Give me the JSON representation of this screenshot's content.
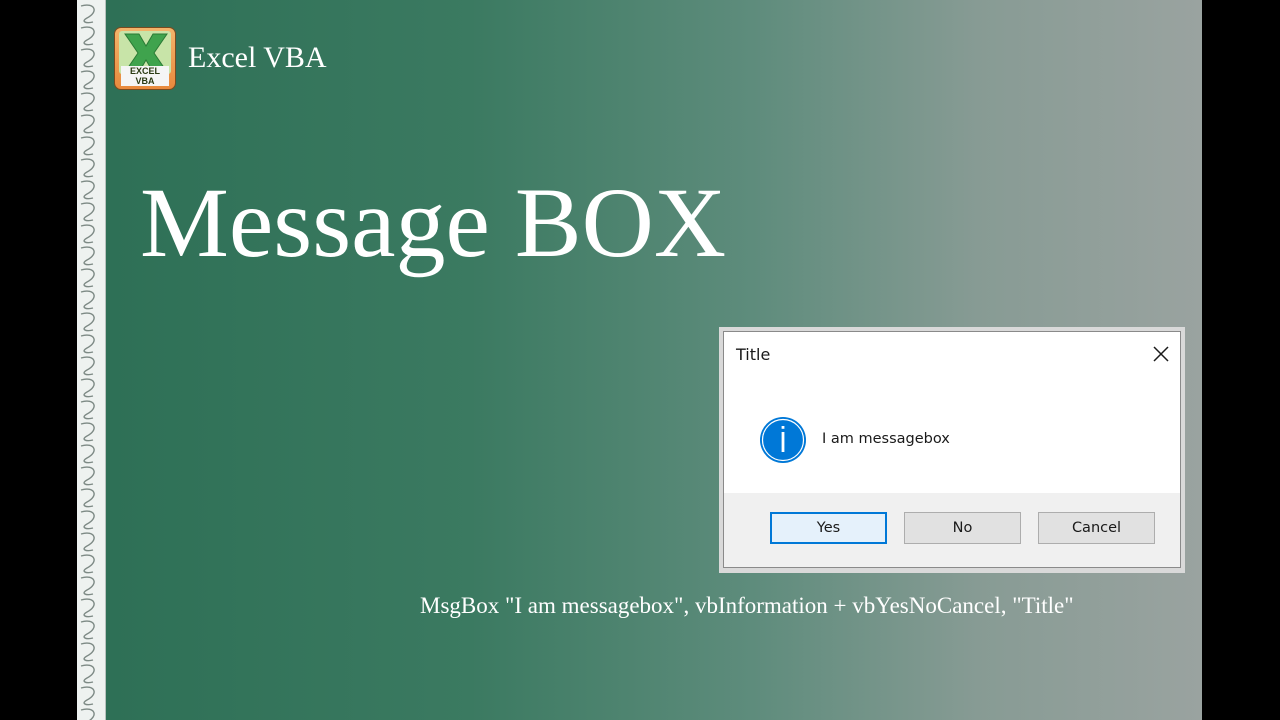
{
  "brand": {
    "logo_text": "EXCEL VBA",
    "name": "Excel VBA"
  },
  "headline": "Message BOX",
  "dialog": {
    "title": "Title",
    "message": "I am messagebox",
    "icon": "info-icon",
    "buttons": {
      "yes": "Yes",
      "no": "No",
      "cancel": "Cancel"
    },
    "default_button": "Yes"
  },
  "code_line": "MsgBox \"I am messagebox\", vbInformation + vbYesNoCancel, \"Title\"",
  "colors": {
    "slide_left": "#2d6f55",
    "slide_right": "#9aa3a0",
    "info_blue": "#0078d7",
    "logo_orange": "#e8893d",
    "logo_green": "#3fa34d"
  }
}
